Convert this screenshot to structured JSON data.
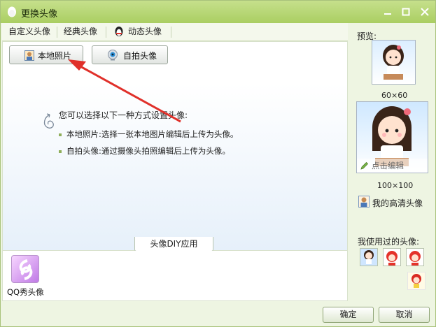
{
  "window": {
    "title": "更换头像"
  },
  "tabs": [
    {
      "label": "自定义头像"
    },
    {
      "label": "经典头像"
    },
    {
      "label": "动态头像"
    }
  ],
  "sources": {
    "local_label": "本地照片",
    "selfie_label": "自拍头像"
  },
  "instructions": {
    "intro": "您可以选择以下一种方式设置头像:",
    "bullets": [
      "本地照片:选择一张本地图片编辑后上传为头像。",
      "自拍头像:通过摄像头拍照编辑后上传为头像。"
    ]
  },
  "diy": {
    "tab_label": "头像DIY应用",
    "app_label": "QQ秀头像"
  },
  "preview": {
    "title": "预览:",
    "small_size": "60×60",
    "large_size": "100×100",
    "edit_label": "点击编辑",
    "hd_label": "我的高清头像",
    "used_title": "我使用过的头像:"
  },
  "footer": {
    "ok_label": "确定",
    "cancel_label": "取消"
  },
  "colors": {
    "titlebar": "#b5d773",
    "accent_arrow": "#e0302a"
  }
}
